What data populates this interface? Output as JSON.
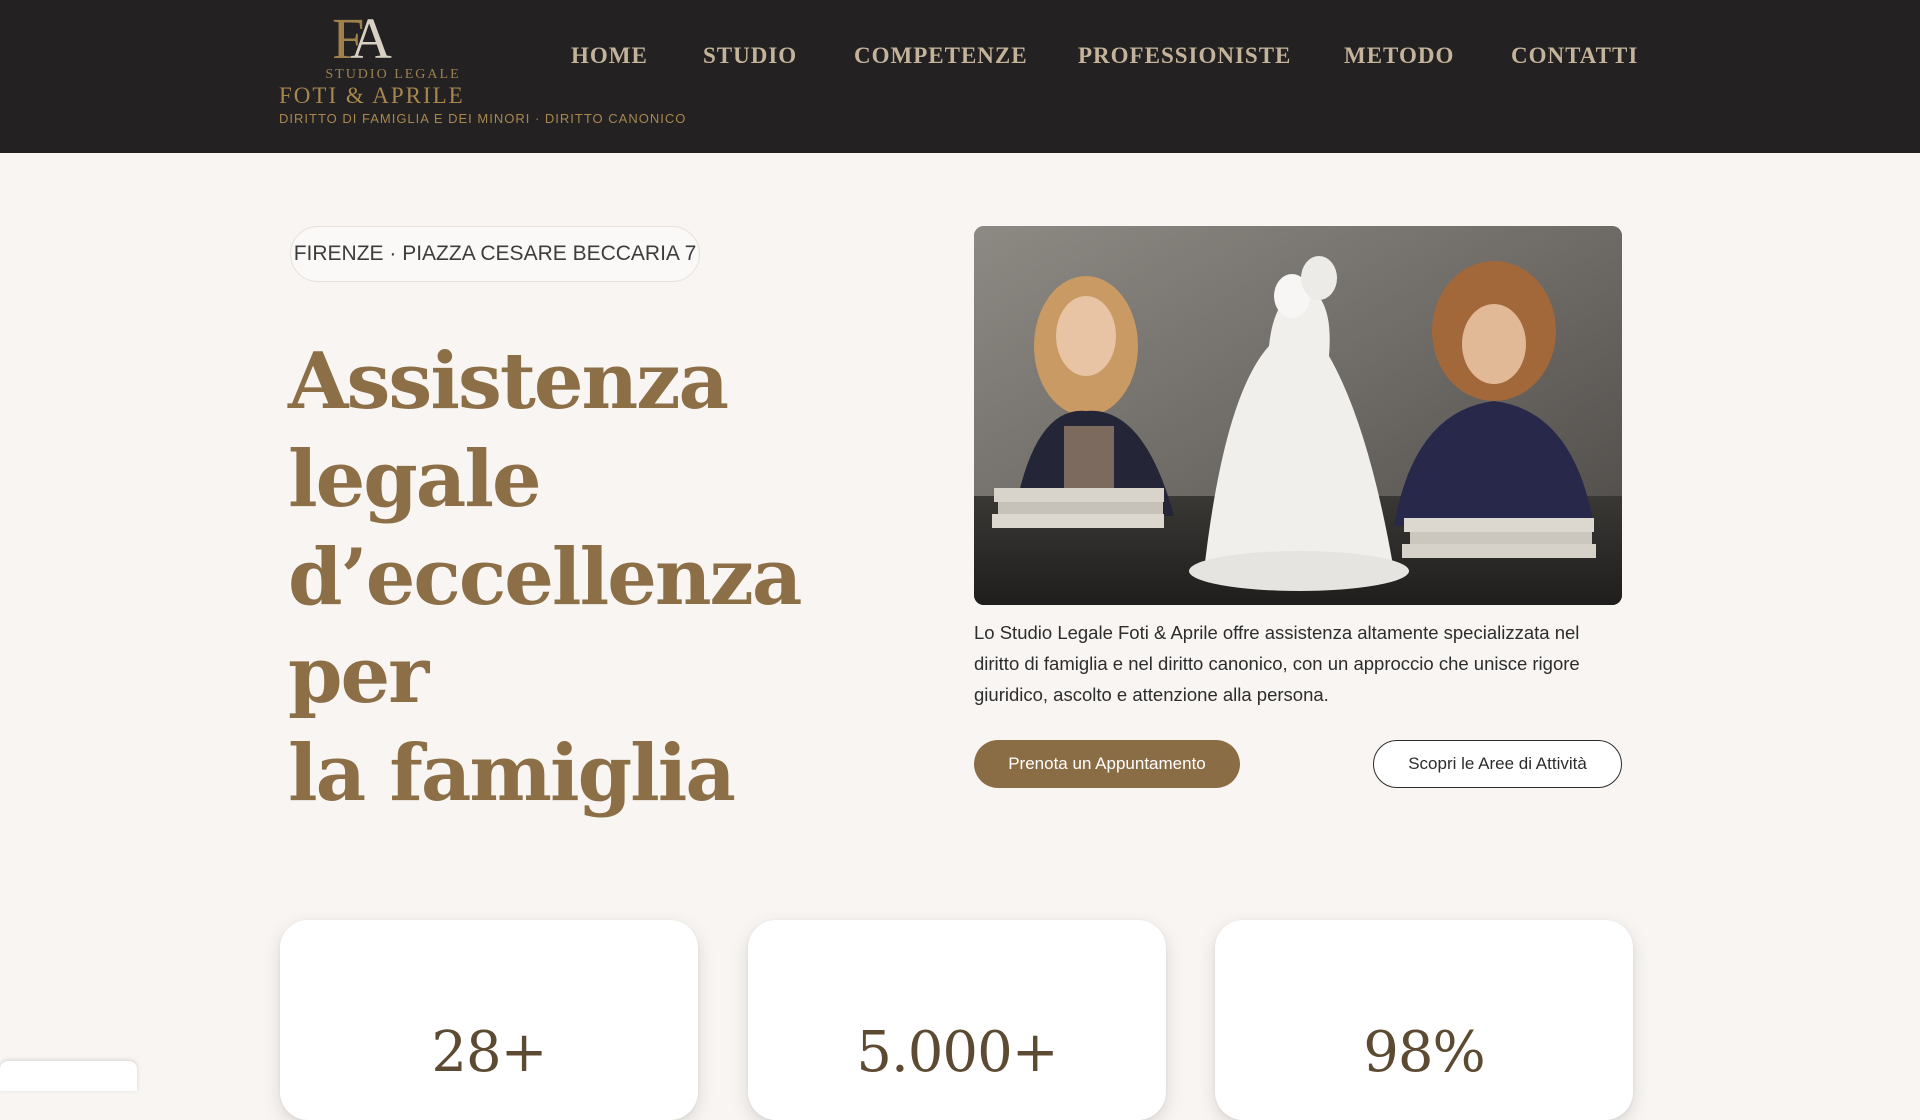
{
  "header": {
    "logo": {
      "mark_f": "F",
      "mark_a": "A",
      "line1": "STUDIO LEGALE",
      "line2": "FOTI & APRILE",
      "tagline": "DIRITTO DI FAMIGLIA E DEI MINORI · DIRITTO CANONICO"
    },
    "nav": [
      {
        "label": "HOME"
      },
      {
        "label": "STUDIO"
      },
      {
        "label": "COMPETENZE"
      },
      {
        "label": "PROFESSIONISTE"
      },
      {
        "label": "METODO"
      },
      {
        "label": "CONTATTI"
      }
    ]
  },
  "hero": {
    "location": "FIRENZE · PIAZZA CESARE BECCARIA 7",
    "title_lines": [
      "Assistenza legale",
      "d’eccellenza per",
      "la famiglia"
    ],
    "description": "Lo Studio Legale Foti & Aprile offre assistenza altamente specializzata nel diritto di famiglia e nel diritto canonico, con un approccio che unisce rigore giuridico, ascolto e attenzione alla persona.",
    "primary_button": "Prenota un Appuntamento",
    "secondary_button": "Scopri le Aree di Attività"
  },
  "stats": [
    {
      "value": "28+"
    },
    {
      "value": "5.000+"
    },
    {
      "value": "98%"
    }
  ],
  "colors": {
    "header_bg": "#232121",
    "page_bg": "#f8f5f2",
    "accent_gold": "#8c6f47",
    "button_brown": "#8b6d45"
  }
}
